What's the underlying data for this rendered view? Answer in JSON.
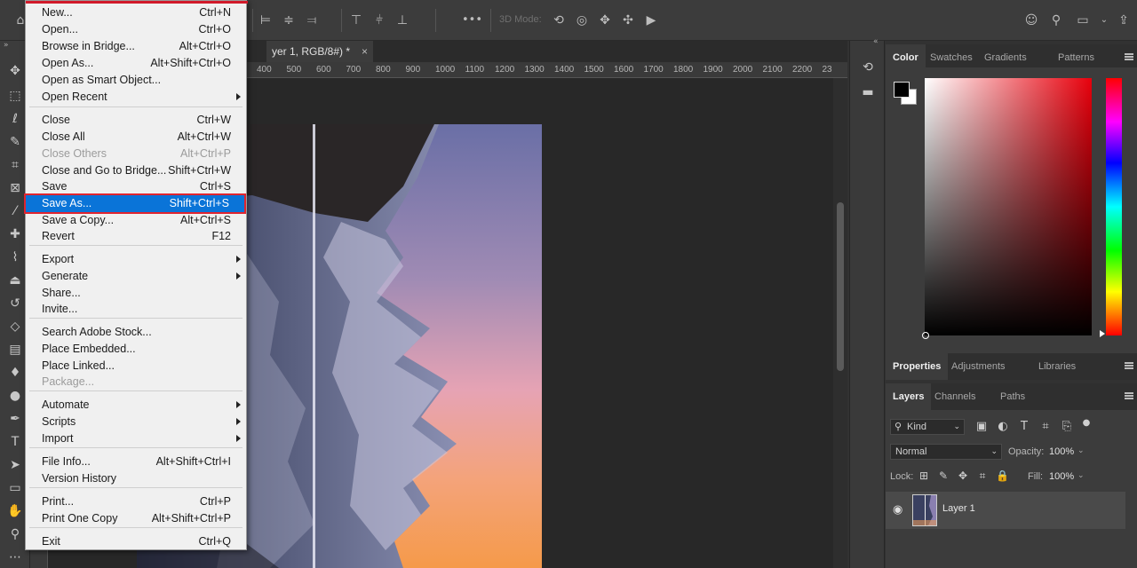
{
  "document": {
    "tab_title": "yer 1, RGB/8#) *",
    "tab_close": "×",
    "ruler_ticks": [
      "400",
      "500",
      "600",
      "700",
      "800",
      "900",
      "1000",
      "1100",
      "1200",
      "1300",
      "1400",
      "1500",
      "1600",
      "1700",
      "1800",
      "1900",
      "2000",
      "2100",
      "2200",
      "23"
    ]
  },
  "options_bar": {
    "mode_3d_label": "3D Mode:",
    "more_label": "•••"
  },
  "file_menu": {
    "items": [
      {
        "label": "New...",
        "shortcut": "Ctrl+N"
      },
      {
        "label": "Open...",
        "shortcut": "Ctrl+O"
      },
      {
        "label": "Browse in Bridge...",
        "shortcut": "Alt+Ctrl+O"
      },
      {
        "label": "Open As...",
        "shortcut": "Alt+Shift+Ctrl+O"
      },
      {
        "label": "Open as Smart Object...",
        "shortcut": ""
      },
      {
        "label": "Open Recent",
        "shortcut": "",
        "submenu": true
      },
      {
        "label": "Close",
        "shortcut": "Ctrl+W"
      },
      {
        "label": "Close All",
        "shortcut": "Alt+Ctrl+W"
      },
      {
        "label": "Close Others",
        "shortcut": "Alt+Ctrl+P",
        "disabled": true
      },
      {
        "label": "Close and Go to Bridge...",
        "shortcut": "Shift+Ctrl+W"
      },
      {
        "label": "Save",
        "shortcut": "Ctrl+S"
      },
      {
        "label": "Save As...",
        "shortcut": "Shift+Ctrl+S",
        "highlighted": true
      },
      {
        "label": "Save a Copy...",
        "shortcut": "Alt+Ctrl+S"
      },
      {
        "label": "Revert",
        "shortcut": "F12"
      },
      {
        "label": "Export",
        "shortcut": "",
        "submenu": true
      },
      {
        "label": "Generate",
        "shortcut": "",
        "submenu": true
      },
      {
        "label": "Share...",
        "shortcut": ""
      },
      {
        "label": "Invite...",
        "shortcut": ""
      },
      {
        "label": "Search Adobe Stock...",
        "shortcut": ""
      },
      {
        "label": "Place Embedded...",
        "shortcut": ""
      },
      {
        "label": "Place Linked...",
        "shortcut": ""
      },
      {
        "label": "Package...",
        "shortcut": "",
        "disabled": true
      },
      {
        "label": "Automate",
        "shortcut": "",
        "submenu": true
      },
      {
        "label": "Scripts",
        "shortcut": "",
        "submenu": true
      },
      {
        "label": "Import",
        "shortcut": "",
        "submenu": true
      },
      {
        "label": "File Info...",
        "shortcut": "Alt+Shift+Ctrl+I"
      },
      {
        "label": "Version History",
        "shortcut": ""
      },
      {
        "label": "Print...",
        "shortcut": "Ctrl+P"
      },
      {
        "label": "Print One Copy",
        "shortcut": "Alt+Shift+Ctrl+P"
      },
      {
        "label": "Exit",
        "shortcut": "Ctrl+Q"
      }
    ]
  },
  "color_panel": {
    "tabs": [
      "Color",
      "Swatches",
      "Gradients",
      "Patterns"
    ],
    "foreground": "#000000",
    "background": "#ffffff",
    "hue_color": "#e8000c"
  },
  "properties_panel": {
    "tabs": [
      "Properties",
      "Adjustments",
      "Libraries"
    ]
  },
  "layers_panel": {
    "tabs": [
      "Layers",
      "Channels",
      "Paths"
    ],
    "filter_kind": "Kind",
    "blend_mode": "Normal",
    "opacity_label": "Opacity:",
    "opacity_value": "100%",
    "lock_label": "Lock:",
    "fill_label": "Fill:",
    "fill_value": "100%",
    "layers": [
      {
        "name": "Layer 1"
      }
    ]
  },
  "icons": {
    "toolbar": [
      "move-icon",
      "marquee-icon",
      "lasso-icon",
      "quick-select-icon",
      "crop-icon",
      "frame-icon",
      "eyedropper-icon",
      "healing-icon",
      "brush-icon",
      "stamp-icon",
      "history-brush-icon",
      "eraser-icon",
      "gradient-icon",
      "blur-icon",
      "dodge-icon",
      "pen-icon",
      "type-icon",
      "path-select-icon",
      "rectangle-icon",
      "hand-icon",
      "zoom-icon",
      "more-icon"
    ]
  }
}
